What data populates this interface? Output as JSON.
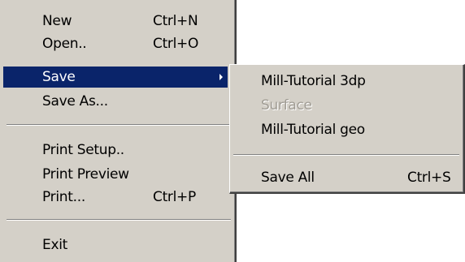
{
  "file_menu": {
    "items": [
      {
        "label": "New",
        "shortcut": "Ctrl+N"
      },
      {
        "label": "Open..",
        "shortcut": "Ctrl+O"
      },
      {
        "label": "Save",
        "shortcut": "",
        "has_submenu": true,
        "highlighted": true
      },
      {
        "label": "Save As...",
        "shortcut": ""
      },
      {
        "label": "Print Setup..",
        "shortcut": ""
      },
      {
        "label": "Print Preview",
        "shortcut": ""
      },
      {
        "label": "Print...",
        "shortcut": "Ctrl+P"
      },
      {
        "label": "Exit",
        "shortcut": ""
      }
    ]
  },
  "save_submenu": {
    "items": [
      {
        "label": "Mill-Tutorial 3dp",
        "shortcut": "",
        "enabled": true
      },
      {
        "label": "Surface",
        "shortcut": "",
        "enabled": false
      },
      {
        "label": "Mill-Tutorial geo",
        "shortcut": "",
        "enabled": true
      },
      {
        "label": "Save All",
        "shortcut": "Ctrl+S",
        "enabled": true
      }
    ]
  },
  "icons": {
    "submenu_arrow": "chevron-right-icon"
  },
  "colors": {
    "menu_background": "#d4d0c8",
    "highlight_background": "#0a246a",
    "highlight_text": "#ffffff",
    "disabled_text": "#a09c94",
    "separator_dark": "#808080",
    "separator_light": "#ffffff"
  }
}
